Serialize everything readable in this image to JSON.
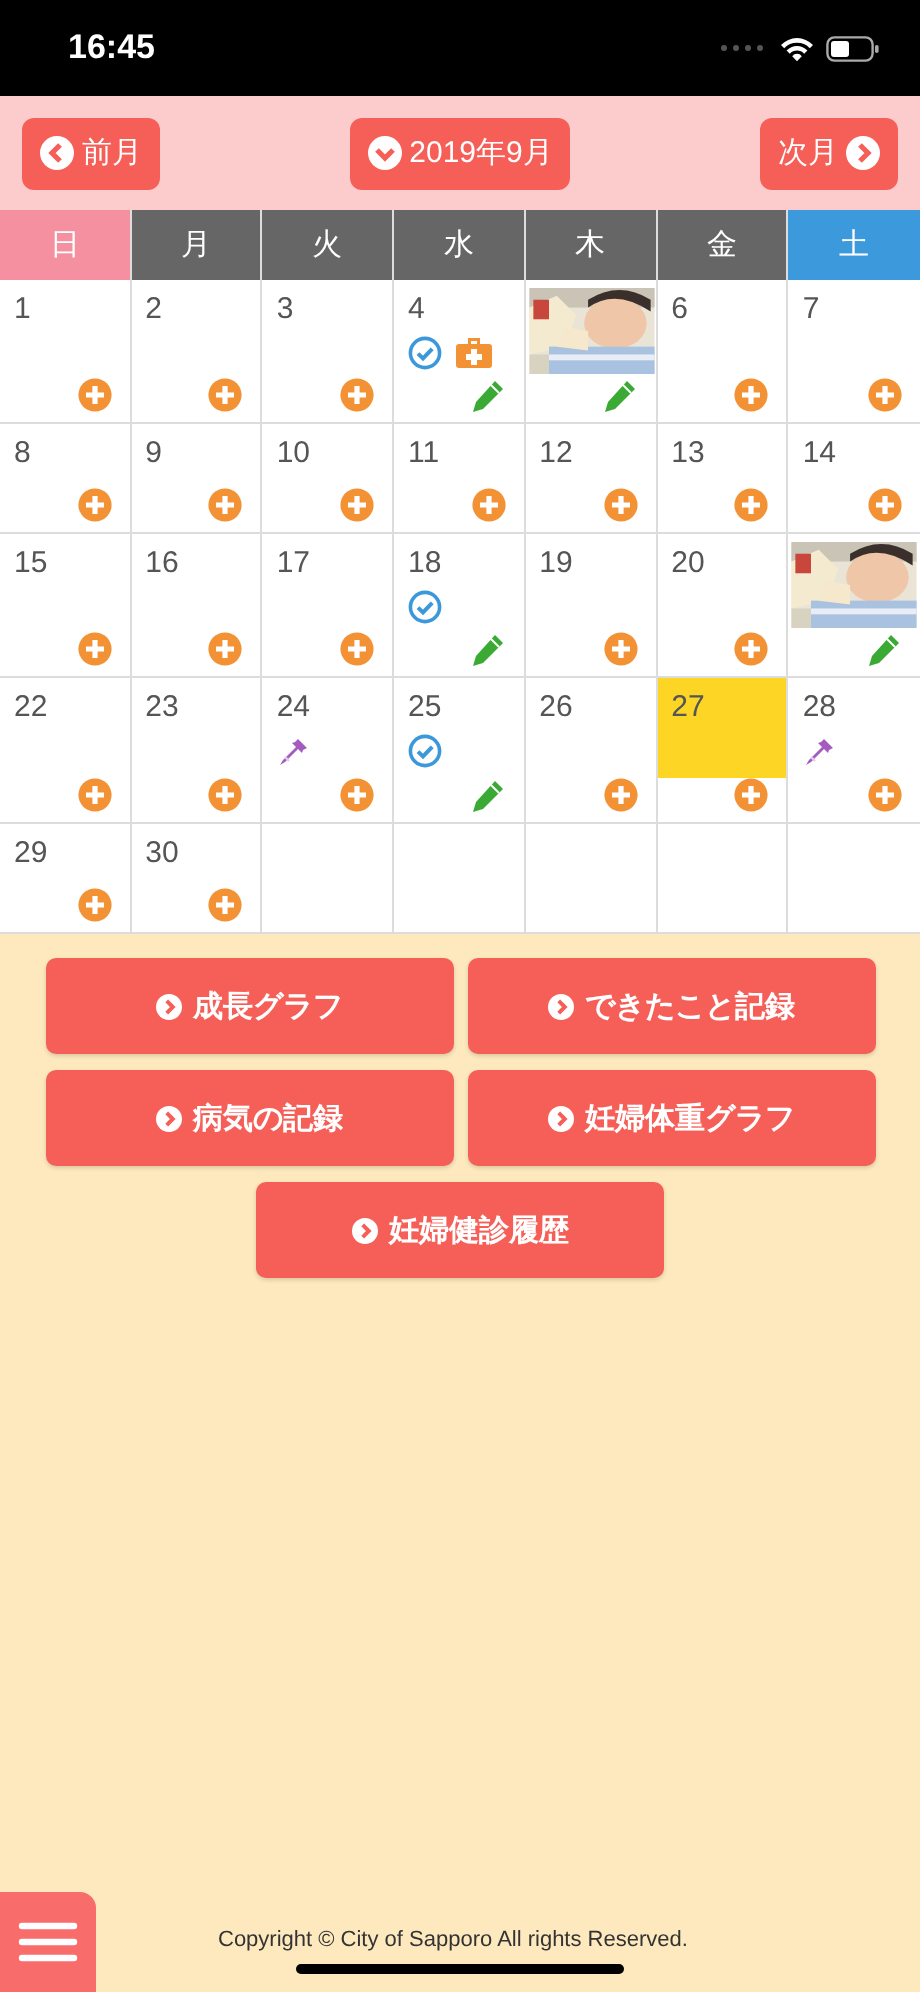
{
  "status_bar": {
    "time": "16:45"
  },
  "nav": {
    "prev": "前月",
    "current": "2019年9月",
    "next": "次月"
  },
  "weekdays": [
    {
      "label": "日",
      "kind": "sunday"
    },
    {
      "label": "月",
      "kind": "weekday"
    },
    {
      "label": "火",
      "kind": "weekday"
    },
    {
      "label": "水",
      "kind": "weekday"
    },
    {
      "label": "木",
      "kind": "weekday"
    },
    {
      "label": "金",
      "kind": "weekday"
    },
    {
      "label": "土",
      "kind": "saturday"
    }
  ],
  "weeks": [
    [
      {
        "kind": "day",
        "day": "1",
        "today": false,
        "action": {
          "kind": "add"
        }
      },
      {
        "kind": "day",
        "day": "2",
        "today": false,
        "action": {
          "kind": "add"
        }
      },
      {
        "kind": "day",
        "day": "3",
        "today": false,
        "action": {
          "kind": "add"
        }
      },
      {
        "kind": "day",
        "day": "4",
        "today": false,
        "icons": [
          {
            "kind": "check"
          },
          {
            "kind": "medical"
          }
        ],
        "action": {
          "kind": "edit"
        }
      },
      {
        "action": {
          "kind": "edit"
        }
      },
      {
        "kind": "day",
        "day": "6",
        "today": false,
        "action": {
          "kind": "add"
        }
      },
      {
        "kind": "day",
        "day": "7",
        "today": false,
        "action": {
          "kind": "add"
        }
      }
    ],
    [
      {
        "kind": "day",
        "day": "8",
        "today": false,
        "action": {
          "kind": "add"
        }
      },
      {
        "kind": "day",
        "day": "9",
        "today": false,
        "action": {
          "kind": "add"
        }
      },
      {
        "kind": "day",
        "day": "10",
        "today": false,
        "action": {
          "kind": "add"
        }
      },
      {
        "kind": "day",
        "day": "11",
        "today": false,
        "action": {
          "kind": "add"
        }
      },
      {
        "kind": "day",
        "day": "12",
        "today": false,
        "action": {
          "kind": "add"
        }
      },
      {
        "kind": "day",
        "day": "13",
        "today": false,
        "action": {
          "kind": "add"
        }
      },
      {
        "kind": "day",
        "day": "14",
        "today": false,
        "action": {
          "kind": "add"
        }
      }
    ],
    [
      {
        "kind": "day",
        "day": "15",
        "today": false,
        "action": {
          "kind": "add"
        }
      },
      {
        "kind": "day",
        "day": "16",
        "today": false,
        "action": {
          "kind": "add"
        }
      },
      {
        "kind": "day",
        "day": "17",
        "today": false,
        "action": {
          "kind": "add"
        }
      },
      {
        "kind": "day",
        "day": "18",
        "today": false,
        "icons": [
          {
            "kind": "check"
          }
        ],
        "action": {
          "kind": "edit"
        }
      },
      {
        "kind": "day",
        "day": "19",
        "today": false,
        "action": {
          "kind": "add"
        }
      },
      {
        "kind": "day",
        "day": "20",
        "today": false,
        "action": {
          "kind": "add"
        }
      },
      {
        "action": {
          "kind": "edit"
        }
      }
    ],
    [
      {
        "kind": "day",
        "day": "22",
        "today": false,
        "action": {
          "kind": "add"
        }
      },
      {
        "kind": "day",
        "day": "23",
        "today": false,
        "action": {
          "kind": "add"
        }
      },
      {
        "kind": "day",
        "day": "24",
        "today": false,
        "icons": [
          {
            "kind": "dropper"
          }
        ],
        "action": {
          "kind": "add"
        }
      },
      {
        "kind": "day",
        "day": "25",
        "today": false,
        "icons": [
          {
            "kind": "check"
          }
        ],
        "action": {
          "kind": "edit"
        }
      },
      {
        "kind": "day",
        "day": "26",
        "today": false,
        "action": {
          "kind": "add"
        }
      },
      {
        "kind": "day",
        "day": "27",
        "today": true,
        "action": {
          "kind": "add"
        }
      },
      {
        "kind": "day",
        "day": "28",
        "today": false,
        "icons": [
          {
            "kind": "dropper"
          }
        ],
        "action": {
          "kind": "add"
        }
      }
    ],
    [
      {
        "kind": "day",
        "day": "29",
        "today": false,
        "action": {
          "kind": "add"
        }
      },
      {
        "kind": "day",
        "day": "30",
        "today": false,
        "action": {
          "kind": "add"
        }
      },
      {
        "kind": "empty"
      },
      {
        "kind": "empty"
      },
      {
        "kind": "empty"
      },
      {
        "kind": "empty"
      },
      {
        "kind": "empty"
      }
    ]
  ],
  "menu_buttons": [
    {
      "label": "成長グラフ"
    },
    {
      "label": "できたこと記録"
    },
    {
      "label": "病気の記録"
    },
    {
      "label": "妊婦体重グラフ"
    },
    {
      "label": "妊婦健診履歴"
    }
  ],
  "footer": {
    "copyright": "Copyright © City of Sapporo All rights Reserved."
  }
}
